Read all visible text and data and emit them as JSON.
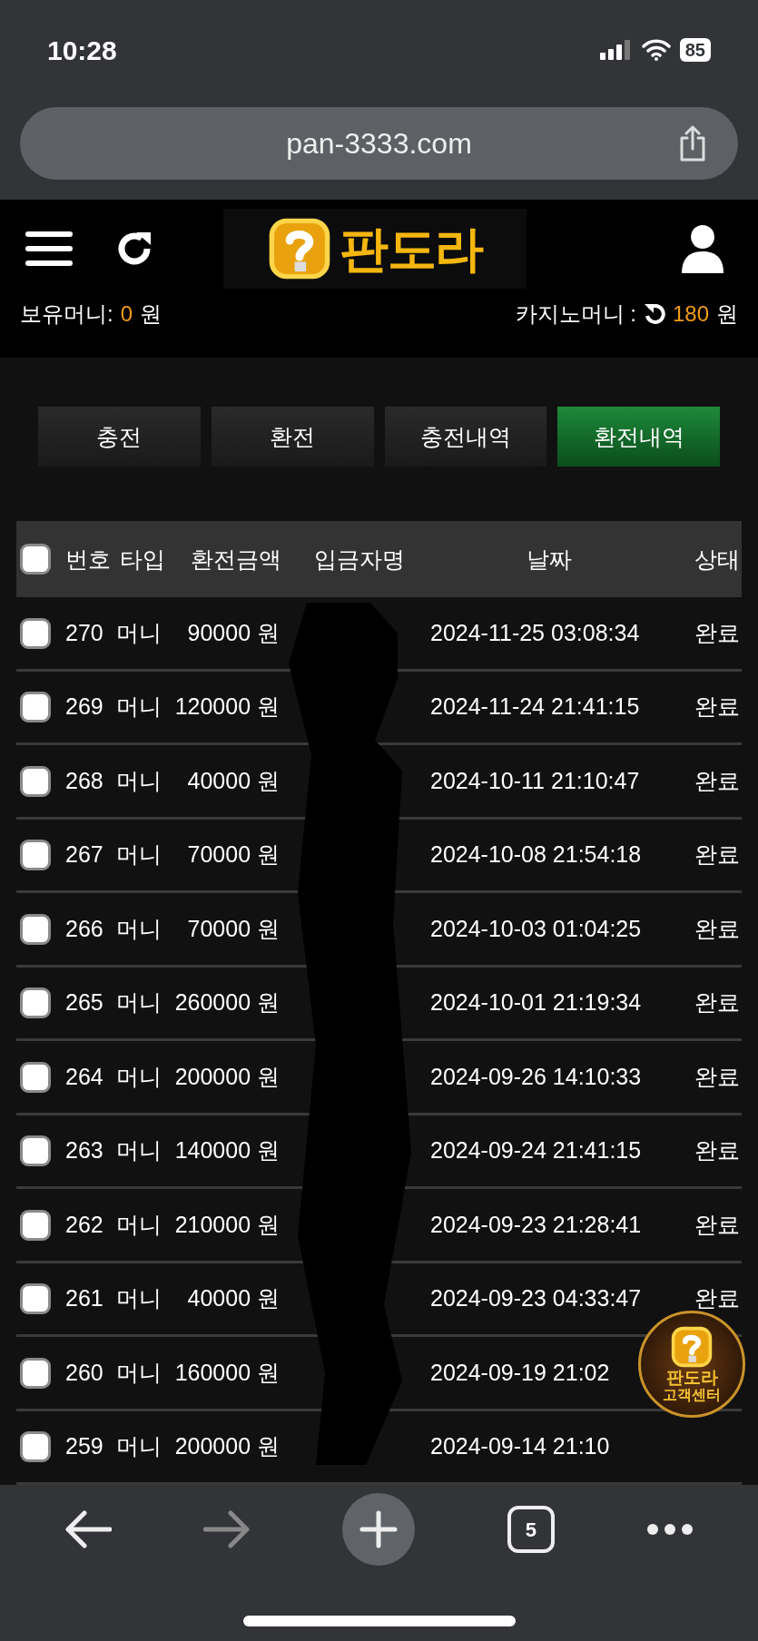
{
  "status_bar": {
    "time": "10:28",
    "battery": "85"
  },
  "browser": {
    "url": "pan-3333.com",
    "tab_count": "5"
  },
  "header": {
    "logo": "판도라",
    "balance_label": "보유머니:",
    "balance_value": "0",
    "balance_unit": "원",
    "casino_label": "카지노머니 :",
    "casino_value": "180",
    "casino_unit": "원"
  },
  "tabs": [
    {
      "label": "충전",
      "selected": false
    },
    {
      "label": "환전",
      "selected": false
    },
    {
      "label": "충전내역",
      "selected": false
    },
    {
      "label": "환전내역",
      "selected": true
    }
  ],
  "table": {
    "header_checked": false,
    "columns": [
      "번호",
      "타입",
      "환전금액",
      "입금자명",
      "날짜",
      "상태"
    ],
    "rows": [
      {
        "checked": false,
        "number": "270",
        "type": "머니",
        "amount": "90000 원",
        "date": "2024-11-25 03:08:34",
        "status": "완료"
      },
      {
        "checked": false,
        "number": "269",
        "type": "머니",
        "amount": "120000 원",
        "date": "2024-11-24 21:41:15",
        "status": "완료"
      },
      {
        "checked": false,
        "number": "268",
        "type": "머니",
        "amount": "40000 원",
        "date": "2024-10-11 21:10:47",
        "status": "완료"
      },
      {
        "checked": false,
        "number": "267",
        "type": "머니",
        "amount": "70000 원",
        "date": "2024-10-08 21:54:18",
        "status": "완료"
      },
      {
        "checked": false,
        "number": "266",
        "type": "머니",
        "amount": "70000 원",
        "date": "2024-10-03 01:04:25",
        "status": "완료"
      },
      {
        "checked": false,
        "number": "265",
        "type": "머니",
        "amount": "260000 원",
        "date": "2024-10-01 21:19:34",
        "status": "완료"
      },
      {
        "checked": false,
        "number": "264",
        "type": "머니",
        "amount": "200000 원",
        "date": "2024-09-26 14:10:33",
        "status": "완료"
      },
      {
        "checked": false,
        "number": "263",
        "type": "머니",
        "amount": "140000 원",
        "date": "2024-09-24 21:41:15",
        "status": "완료"
      },
      {
        "checked": false,
        "number": "262",
        "type": "머니",
        "amount": "210000 원",
        "date": "2024-09-23 21:28:41",
        "status": "완료"
      },
      {
        "checked": false,
        "number": "261",
        "type": "머니",
        "amount": "40000 원",
        "date": "2024-09-23 04:33:47",
        "status": "완료"
      },
      {
        "checked": false,
        "number": "260",
        "type": "머니",
        "amount": "160000 원",
        "date": "2024-09-19 21:02"
      },
      {
        "checked": false,
        "number": "259",
        "type": "머니",
        "amount": "200000 원",
        "date": "2024-09-14 21:10"
      }
    ]
  },
  "support_badge": {
    "title": "판도라",
    "subtitle": "고객센터"
  }
}
